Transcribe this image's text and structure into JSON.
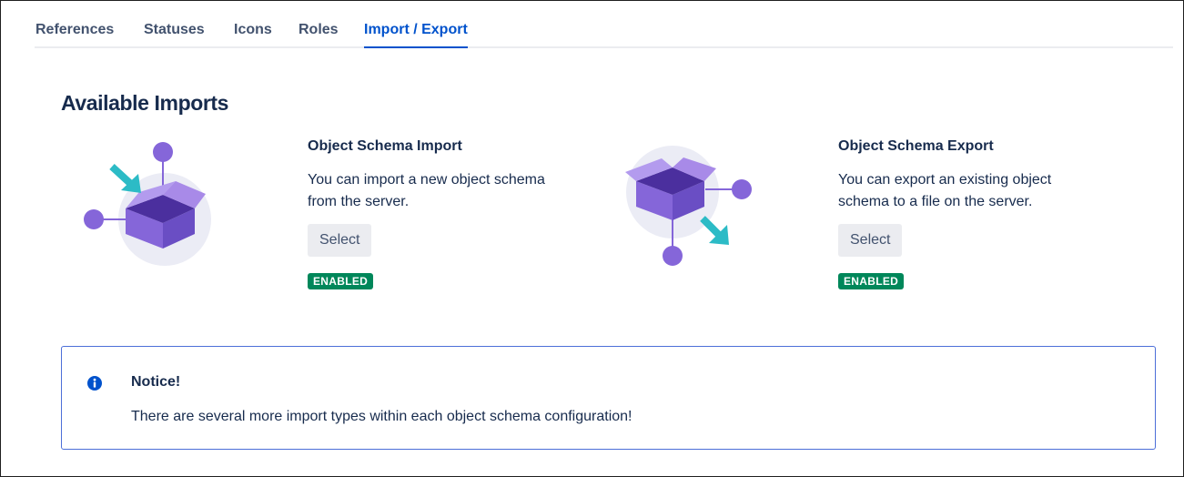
{
  "tabs": [
    {
      "label": "References",
      "active": false
    },
    {
      "label": "Statuses",
      "active": false
    },
    {
      "label": "Icons",
      "active": false
    },
    {
      "label": "Roles",
      "active": false
    },
    {
      "label": "Import / Export",
      "active": true
    }
  ],
  "section": {
    "title": "Available Imports"
  },
  "cards": [
    {
      "title": "Object Schema Import",
      "description": "You can import a new object schema from the server.",
      "button_label": "Select",
      "status": "ENABLED",
      "illustration_icon": "box-import-illustration"
    },
    {
      "title": "Object Schema Export",
      "description": "You can export an existing object schema to a file on the server.",
      "button_label": "Select",
      "status": "ENABLED",
      "illustration_icon": "box-export-illustration"
    }
  ],
  "notice": {
    "icon": "info-icon",
    "title": "Notice!",
    "body": "There are several more import types within each object schema configuration!"
  },
  "colors": {
    "accent": "#0052cc",
    "status_enabled": "#00875a",
    "box_purple": "#8566d9",
    "arrow_teal": "#2cbbc6",
    "notice_border": "#4c6fd8"
  }
}
